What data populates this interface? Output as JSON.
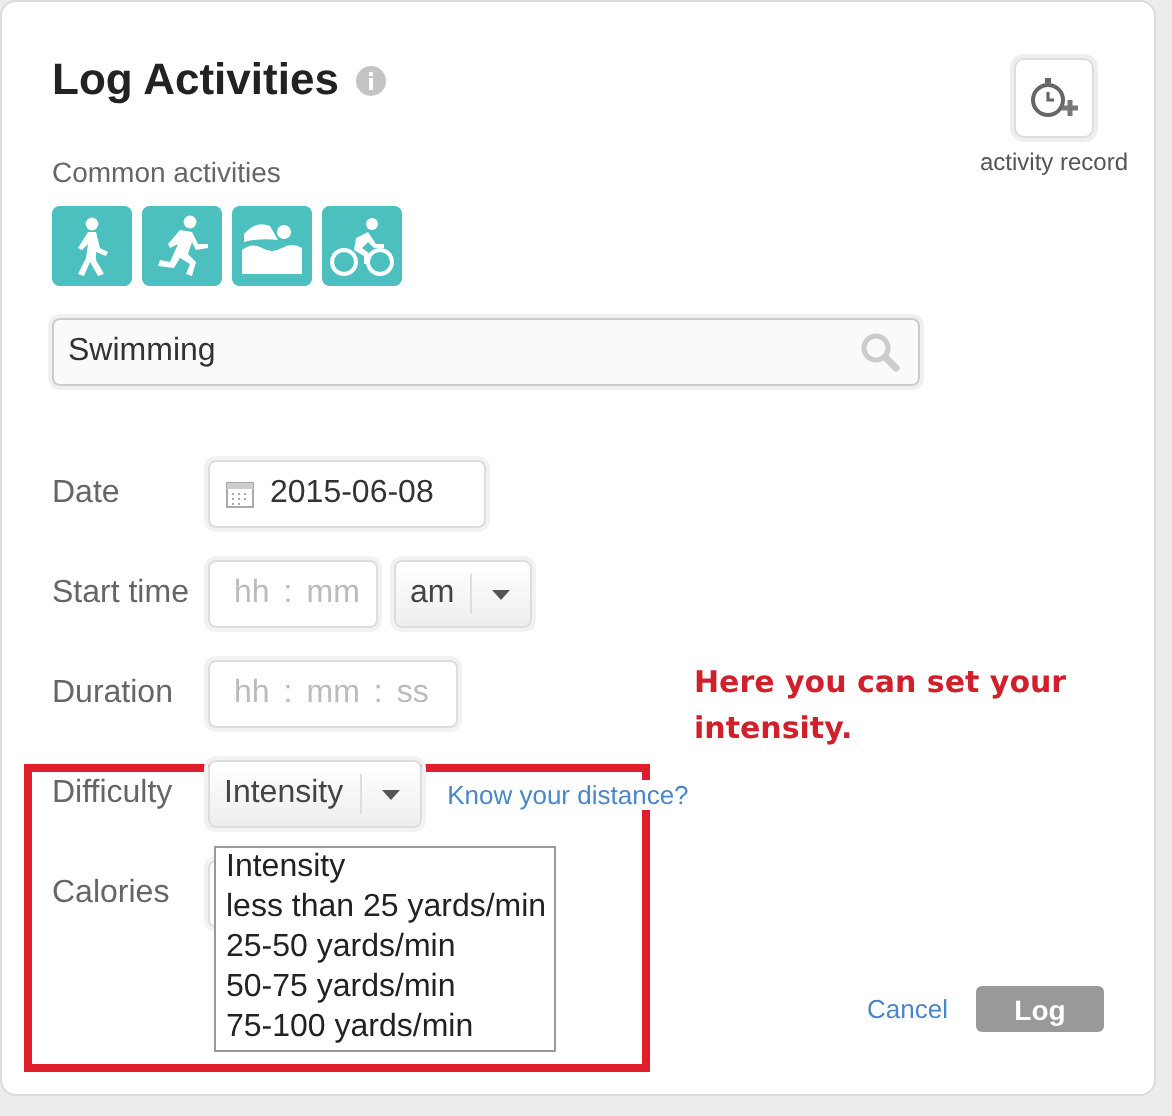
{
  "dialog": {
    "title": "Log Activities"
  },
  "record_button": {
    "label": "activity record"
  },
  "common": {
    "label": "Common activities",
    "activities": [
      {
        "kind": "walk"
      },
      {
        "kind": "run"
      },
      {
        "kind": "swim"
      },
      {
        "kind": "bike"
      }
    ]
  },
  "search": {
    "value": "Swimming"
  },
  "fields": [
    {
      "kind": "date",
      "label": "Date",
      "value": "2015-06-08"
    },
    {
      "kind": "time",
      "label": "Start time",
      "parts": [
        "hh",
        ":",
        "mm"
      ],
      "ampm": "am"
    },
    {
      "kind": "duration",
      "label": "Duration",
      "parts": [
        "hh",
        ":",
        "mm",
        ":",
        "ss"
      ]
    },
    {
      "kind": "select",
      "label": "Difficulty",
      "value": "Intensity",
      "link": "Know your distance?",
      "options": [
        "Intensity",
        "less than 25 yards/min",
        "25-50 yards/min",
        "50-75 yards/min",
        "75-100 yards/min"
      ]
    },
    {
      "kind": "blank",
      "label": "Calories"
    }
  ],
  "buttons": [
    {
      "kind": "link",
      "label": "Cancel",
      "disabled": false
    },
    {
      "kind": "primary",
      "label": "Log",
      "disabled": true
    }
  ],
  "annotation": {
    "text": "Here you can set your intensity."
  }
}
